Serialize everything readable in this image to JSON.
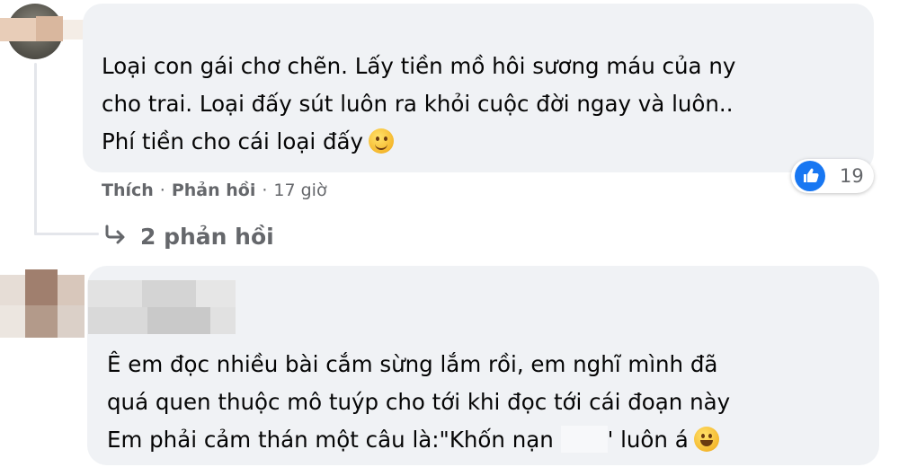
{
  "comment1": {
    "lines": [
      "Loại con gái chơ chẽn. Lấy tiền mồ hôi sương máu của ny",
      "cho trai. Loại đấy sút luôn ra khỏi cuộc đời ngay và luôn..",
      "Phí tiền cho cái loại đấy"
    ],
    "emoji": "smirk-emoji",
    "reaction_icon": "like-icon",
    "reaction_count": "19",
    "actions": {
      "like": "Thích",
      "reply": "Phản hồi",
      "time": "17 giờ"
    },
    "replies_label": "2 phản hồi"
  },
  "comment2": {
    "lines": [
      "Ê em đọc nhiều bài cắm sừng lắm rồi, em nghĩ mình đã",
      "quá quen thuộc mô tuýp cho tới khi đọc tới cái đoạn này"
    ],
    "line3_before": "Em phải cảm thán một câu là:\"Khốn nạn ",
    "line3_after": "' luôn á",
    "emoji": "grinning-emoji"
  },
  "colors": {
    "bubble": "#f0f2f5",
    "text": "#050505",
    "secondary": "#65676b",
    "like_blue": "#1877f2"
  }
}
